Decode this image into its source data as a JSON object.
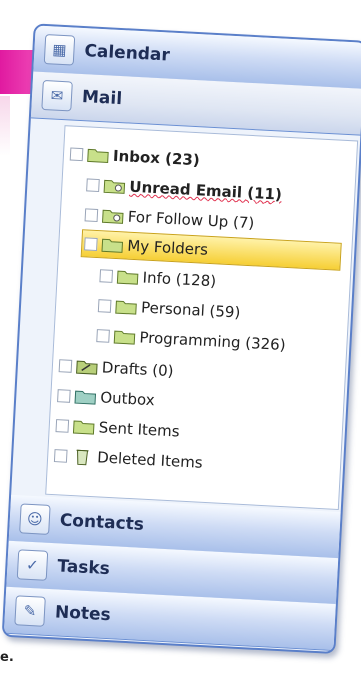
{
  "nav": {
    "calendar": {
      "label": "Calendar",
      "icon": "calendar-icon"
    },
    "mail": {
      "label": "Mail",
      "icon": "mail-icon"
    },
    "contacts": {
      "label": "Contacts",
      "icon": "contacts-icon"
    },
    "tasks": {
      "label": "Tasks",
      "icon": "tasks-icon"
    },
    "notes": {
      "label": "Notes",
      "icon": "notes-icon"
    }
  },
  "tree": {
    "inbox": "Inbox (23)",
    "unread": "Unread Email (11)",
    "follow_up": "For Follow Up (7)",
    "my_folders": "My Folders",
    "info": "Info (128)",
    "personal": "Personal (59)",
    "programming": "Programming (326)",
    "drafts": "Drafts (0)",
    "outbox": "Outbox",
    "sent": "Sent Items",
    "deleted": "Deleted Items"
  },
  "colors": {
    "accent": "#e01aa0",
    "selected": "#f6cf35",
    "header_blue": "#a9c0ea",
    "unread_underline": "#e0304e"
  },
  "footer": {
    "text": "e."
  }
}
